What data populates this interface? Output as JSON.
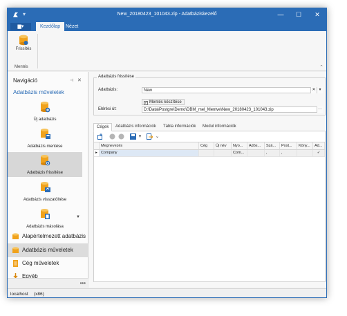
{
  "window": {
    "title": "New_20180423_101043.zip - Adatbáziskezelő",
    "controls": {
      "minimize": "—",
      "maximize": "☐",
      "close": "✕"
    }
  },
  "ribbon": {
    "file_label": "▆▾",
    "tabs": [
      {
        "label": "Kezdőlap",
        "active": true
      },
      {
        "label": "Nézet",
        "active": false
      }
    ],
    "buttons": [
      {
        "label": "Frissítés",
        "icon": "database-refresh-icon"
      }
    ],
    "group_label": "Mentés",
    "collapse_icon": "chevron-up-icon"
  },
  "nav": {
    "title": "Navigáció",
    "section": "Adatbázis műveletek",
    "items": [
      {
        "label": "Új adatbázis",
        "icon": "database-add-icon",
        "selected": false
      },
      {
        "label": "Adatbázis mentése",
        "icon": "database-save-icon",
        "selected": false
      },
      {
        "label": "Adatbázis frissítése",
        "icon": "database-refresh-icon",
        "selected": true
      },
      {
        "label": "Adatbázis visszatöltése",
        "icon": "database-restore-icon",
        "selected": false
      },
      {
        "label": "Adatbázis másolása",
        "icon": "database-copy-icon",
        "selected": false
      }
    ],
    "groups": [
      {
        "label": "Alapértelmezett adatbázis",
        "icon": "database-icon",
        "active": false
      },
      {
        "label": "Adatbázis műveletek",
        "icon": "database-icon",
        "active": true
      },
      {
        "label": "Cég műveletek",
        "icon": "document-icon",
        "active": false
      },
      {
        "label": "Egyéb",
        "icon": "download-icon",
        "active": false
      }
    ],
    "more": "▼",
    "footer_dots": "•••"
  },
  "form": {
    "legend": "Adatbázis frissítése",
    "db_label": "Adatbázis:",
    "db_value": "New",
    "save_checkbox": "Mentés készítése",
    "save_checked": true,
    "path_label": "Elérési út:",
    "path_value": "D:\\Data\\Postgre\\Demo\\DBM_mel_Mentve\\New_20180423_101043.zip"
  },
  "tabs": [
    {
      "label": "Cégek",
      "active": true
    },
    {
      "label": "Adatbázis információk",
      "active": false
    },
    {
      "label": "Tábla információk",
      "active": false
    },
    {
      "label": "Modul információk",
      "active": false
    }
  ],
  "toolbar": {
    "icons": [
      "new-icon",
      "stop-icon",
      "stop-icon",
      "save-icon",
      "dropdown-icon",
      "export-icon",
      "chevron-down-icon"
    ]
  },
  "grid": {
    "columns": [
      "Megnevezés",
      "Cég",
      "Új név",
      "Nyo...",
      "Adós...",
      "Szá...",
      "Post...",
      "Köny...",
      "Ad..."
    ],
    "rows": [
      {
        "indicator": "▸",
        "cells": [
          "Company",
          "",
          "",
          "Com...",
          "",
          ",",
          ",",
          "",
          "✓"
        ]
      }
    ]
  },
  "status": {
    "host": "localhost",
    "arch": "(x86)"
  }
}
